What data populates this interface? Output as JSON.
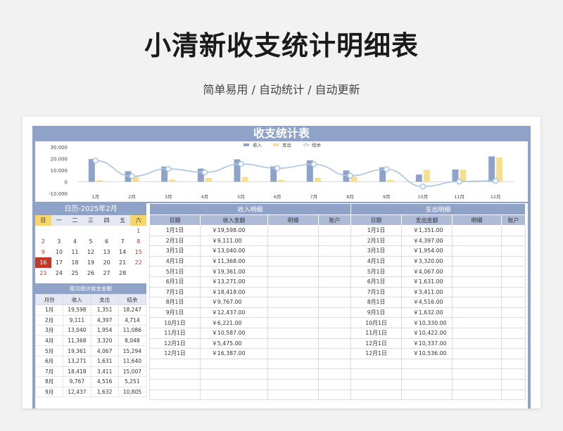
{
  "page": {
    "title": "小清新收支统计明细表",
    "subtitle": "简单易用 / 自动统计 / 自动更新"
  },
  "sheet": {
    "title": "收支统计表"
  },
  "chart_data": {
    "type": "bar",
    "categories": [
      "1月",
      "2月",
      "3月",
      "4月",
      "5月",
      "6月",
      "7月",
      "8月",
      "9月",
      "10月",
      "11月",
      "12月"
    ],
    "series": [
      {
        "name": "收入",
        "values": [
          19.598,
          9.111,
          13.04,
          11.368,
          19.361,
          13.271,
          18.418,
          9.767,
          12.437,
          6.221,
          10.587,
          21.862
        ]
      },
      {
        "name": "支出",
        "values": [
          1.351,
          4.397,
          1.954,
          3.32,
          4.067,
          1.631,
          3.411,
          4.516,
          1.632,
          10.33,
          10.422,
          21.0
        ]
      },
      {
        "name": "结余",
        "values": [
          18.247,
          4.714,
          11.086,
          8.048,
          15.294,
          11.64,
          15.007,
          5.251,
          10.805,
          -4.109,
          0.165,
          0.862
        ]
      }
    ],
    "yticks": [
      "30.000",
      "20.000",
      "10.000",
      "0",
      "-10.000"
    ],
    "ylim": [
      -10,
      30
    ],
    "grid": false,
    "legend": "top-center",
    "colors": {
      "income": "#8fa3c9",
      "expense": "#f6df8f",
      "balance": "#a9c4e3"
    }
  },
  "calendar": {
    "title": "日历-2025年2月",
    "weekdays": [
      "日",
      "一",
      "二",
      "三",
      "四",
      "五",
      "六"
    ],
    "weeks": [
      [
        "",
        "",
        "",
        "",
        "",
        "",
        "1"
      ],
      [
        "2",
        "3",
        "4",
        "5",
        "6",
        "7",
        "8"
      ],
      [
        "9",
        "10",
        "11",
        "12",
        "13",
        "14",
        "15"
      ],
      [
        "16",
        "17",
        "18",
        "19",
        "20",
        "21",
        "22"
      ],
      [
        "23",
        "24",
        "25",
        "26",
        "27",
        "28",
        ""
      ]
    ],
    "today": "16"
  },
  "monthly": {
    "title": "按月统计收支金额",
    "headers": [
      "月份",
      "收入",
      "支出",
      "结余"
    ],
    "rows": [
      [
        "1月",
        "19,598",
        "1,351",
        "18,247"
      ],
      [
        "2月",
        "9,111",
        "4,397",
        "4,714"
      ],
      [
        "3月",
        "13,040",
        "1,954",
        "11,086"
      ],
      [
        "4月",
        "11,368",
        "3,320",
        "8,048"
      ],
      [
        "5月",
        "19,361",
        "4,067",
        "15,294"
      ],
      [
        "6月",
        "13,271",
        "1,631",
        "11,640"
      ],
      [
        "7月",
        "18,418",
        "3,411",
        "15,007"
      ],
      [
        "8月",
        "9,767",
        "4,516",
        "5,251"
      ],
      [
        "9月",
        "12,437",
        "1,632",
        "10,805"
      ]
    ]
  },
  "detail": {
    "income_title": "收入明细",
    "expense_title": "支出明细",
    "headers": [
      "日期",
      "收入金额",
      "明细",
      "账户",
      "日期",
      "支出金额",
      "明细",
      "账户"
    ],
    "rows": [
      [
        "1月1日",
        "￥19,598.00",
        "",
        "",
        "1月1日",
        "￥1,351.00",
        "",
        ""
      ],
      [
        "2月1日",
        "￥9,111.00",
        "",
        "",
        "2月1日",
        "￥4,397.00",
        "",
        ""
      ],
      [
        "3月1日",
        "￥13,040.00",
        "",
        "",
        "3月1日",
        "￥1,954.00",
        "",
        ""
      ],
      [
        "4月1日",
        "￥11,368.00",
        "",
        "",
        "4月1日",
        "￥3,320.00",
        "",
        ""
      ],
      [
        "5月1日",
        "￥19,361.00",
        "",
        "",
        "5月1日",
        "￥4,067.00",
        "",
        ""
      ],
      [
        "6月1日",
        "￥13,271.00",
        "",
        "",
        "6月1日",
        "￥1,631.00",
        "",
        ""
      ],
      [
        "7月1日",
        "￥18,418.00",
        "",
        "",
        "7月1日",
        "￥3,411.00",
        "",
        ""
      ],
      [
        "8月1日",
        "￥9,767.00",
        "",
        "",
        "8月1日",
        "￥4,516.00",
        "",
        ""
      ],
      [
        "9月1日",
        "￥12,437.00",
        "",
        "",
        "9月1日",
        "￥1,632.00",
        "",
        ""
      ],
      [
        "10月1日",
        "￥6,221.00",
        "",
        "",
        "10月1日",
        "￥10,330.00",
        "",
        ""
      ],
      [
        "11月1日",
        "￥10,587.00",
        "",
        "",
        "11月1日",
        "￥10,422.00",
        "",
        ""
      ],
      [
        "12月1日",
        "￥5,475.00",
        "",
        "",
        "12月1日",
        "￥10,337.00",
        "",
        ""
      ],
      [
        "12月1日",
        "￥16,387.00",
        "",
        "",
        "12月1日",
        "￥10,536.00",
        "",
        ""
      ],
      [
        "",
        "",
        "",
        "",
        "",
        "",
        "",
        ""
      ],
      [
        "",
        "",
        "",
        "",
        "",
        "",
        "",
        ""
      ],
      [
        "",
        "",
        "",
        "",
        "",
        "",
        "",
        ""
      ],
      [
        "",
        "",
        "",
        "",
        "",
        "",
        "",
        ""
      ]
    ]
  }
}
